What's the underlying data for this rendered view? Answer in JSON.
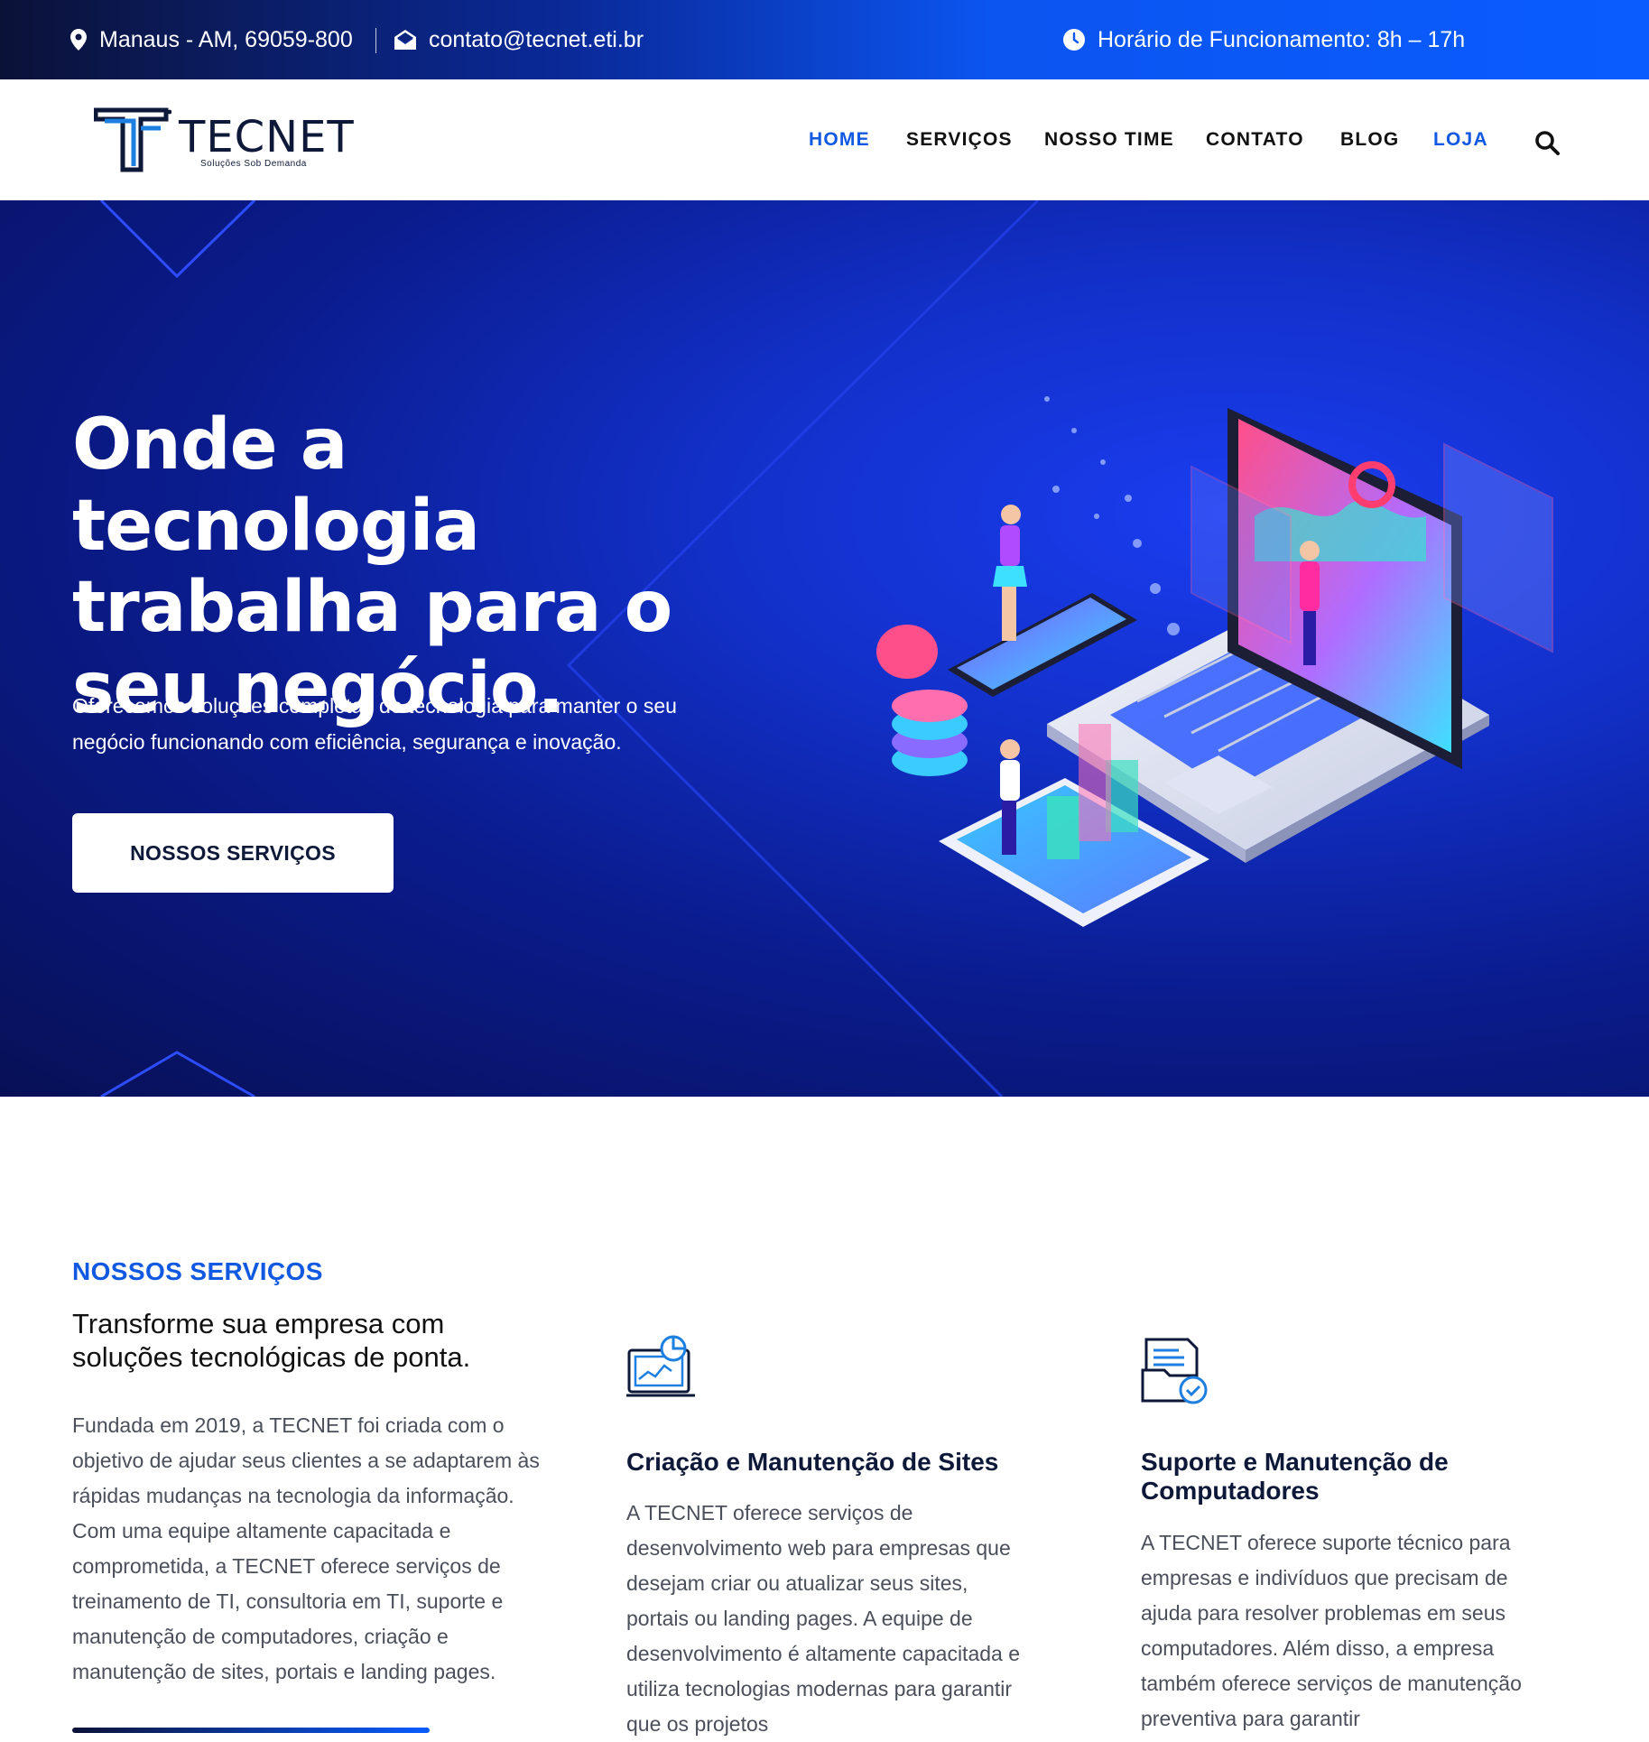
{
  "topbar": {
    "location": "Manaus - AM, 69059-800",
    "email": "contato@tecnet.eti.br",
    "hours": "Horário de Funcionamento: 8h – 17h"
  },
  "header": {
    "logo_brand": "TECNET",
    "logo_tagline": "Soluções Sob Demanda",
    "nav": [
      {
        "label": "HOME",
        "active": true
      },
      {
        "label": "SERVIÇOS",
        "active": false
      },
      {
        "label": "NOSSO TIME",
        "active": false
      },
      {
        "label": "CONTATO",
        "active": false
      },
      {
        "label": "BLOG",
        "active": false
      },
      {
        "label": "LOJA",
        "active": true
      }
    ]
  },
  "hero": {
    "headline": "Onde a tecnologia trabalha para o seu negócio.",
    "subtitle": "Oferecemos soluções completas de tecnologia para manter o seu negócio funcionando com eficiência, segurança e inovação.",
    "cta_label": "NOSSOS SERVIÇOS"
  },
  "services": {
    "kicker": "NOSSOS SERVIÇOS",
    "title": "Transforme sua empresa com soluções tecnológicas de ponta.",
    "description": "Fundada em 2019, a TECNET foi criada com o objetivo de ajudar seus clientes a se adaptarem às rápidas mudanças na tecnologia da informação. Com uma equipe altamente capacitada e comprometida, a TECNET oferece serviços de treinamento de TI, consultoria em TI, suporte e manutenção de computadores, criação e manutenção de sites, portais e landing pages.",
    "cards": [
      {
        "title": "Criação e Manutenção de Sites",
        "body": "A TECNET oferece serviços de desenvolvimento web para empresas que desejam criar ou atualizar seus sites, portais ou landing pages. A equipe de desenvolvimento é altamente capacitada e utiliza tecnologias modernas para garantir que os projetos",
        "icon": "web-dashboard-icon"
      },
      {
        "title": "Suporte e Manutenção de Computadores",
        "body": "A TECNET oferece suporte técnico para empresas e indivíduos que precisam de ajuda para resolver problemas em seus computadores. Além disso, a empresa também oferece serviços de manutenção preventiva para garantir",
        "icon": "document-check-icon"
      }
    ]
  },
  "colors": {
    "accent": "#1159e0",
    "hero_dark": "#071056",
    "hero_bright": "#1a3df0"
  }
}
